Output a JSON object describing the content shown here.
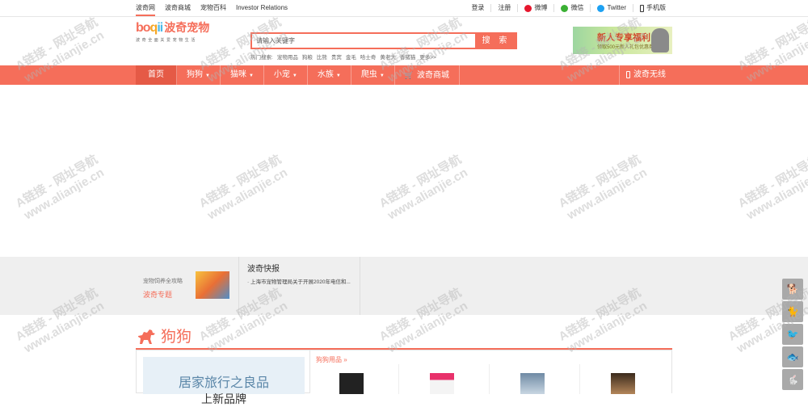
{
  "topbar": {
    "links": [
      "波奇网",
      "波奇商城",
      "宠物百科",
      "Investor Relations"
    ],
    "right": [
      "登录",
      "注册",
      "微博",
      "微信",
      "Twitter",
      "手机版"
    ]
  },
  "logo": {
    "text": "波奇宠物",
    "tagline": "波奇全面关爱宠物生活"
  },
  "search": {
    "placeholder": "请输入关键字",
    "button": "搜 索",
    "hot_label": "热门搜索:",
    "hot": [
      "宠物用品",
      "狗粮",
      "比熊",
      "贵宾",
      "金毛",
      "哈士奇",
      "黄老大",
      "香猪猫",
      "更多>>"
    ]
  },
  "banner": {
    "title": "新人专享福利",
    "sub": "领取500元新人礼包优惠券"
  },
  "nav": {
    "items": [
      {
        "label": "首页",
        "dropdown": false
      },
      {
        "label": "狗狗",
        "dropdown": true
      },
      {
        "label": "猫咪",
        "dropdown": true
      },
      {
        "label": "小宠",
        "dropdown": true
      },
      {
        "label": "水族",
        "dropdown": true
      },
      {
        "label": "爬虫",
        "dropdown": true
      },
      {
        "label": "波奇商城",
        "dropdown": false
      }
    ],
    "mobile": "波奇无线"
  },
  "promo": {
    "small": "宠物饲养全攻略",
    "big": "波奇专题"
  },
  "news": {
    "title": "波奇快报",
    "items": [
      "上海市宠物管理局关于开展2020年电信和..."
    ]
  },
  "section": {
    "title": "狗狗",
    "products_header": "狗狗用品 »",
    "ad_line1": "居家旅行之良品",
    "ad_line2": "上新品牌"
  },
  "products": [
    "dog-food-1",
    "dog-food-2",
    "dog-food-3",
    "dog-food-4"
  ],
  "watermark": {
    "line1": "A链接 - 网址导航",
    "line2": "www.alianjie.cn"
  },
  "side_tools": [
    "dog",
    "cat",
    "bird",
    "fish",
    "rabbit"
  ],
  "colors": {
    "accent": "#f56e5a",
    "nav_active": "#e55a46",
    "gray_band": "#efefef"
  }
}
